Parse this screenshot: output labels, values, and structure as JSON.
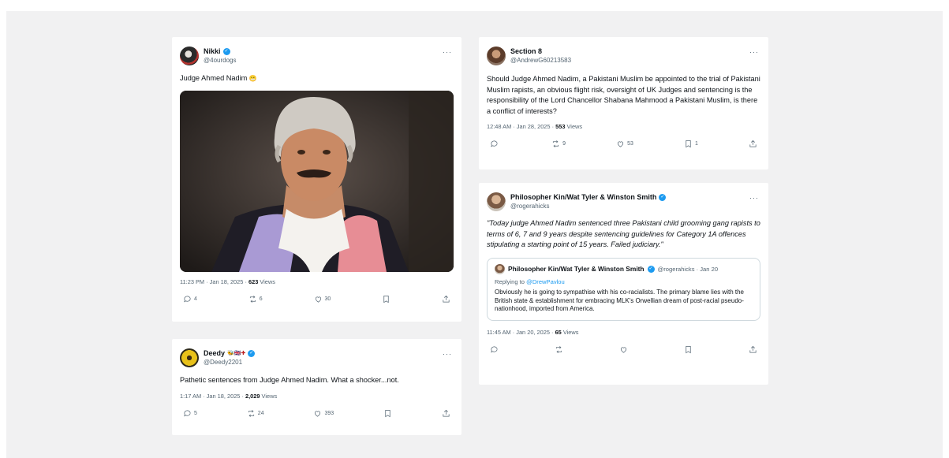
{
  "tweets": [
    {
      "name": "Nikki",
      "handle": "@4ourdogs",
      "text": "Judge Ahmed Nadim",
      "emoji": "😬",
      "time": "11:23 PM · Jan 18, 2025 · ",
      "views_count": "623",
      "views_label": " Views",
      "replies": "4",
      "retweets": "6",
      "likes": "30",
      "bookmarks": "",
      "verified": true
    },
    {
      "name": "Deedy",
      "flags": "🐝🇬🇧✚",
      "handle": "@Deedy2201",
      "text": "Pathetic sentences from Judge Ahmed Nadim. What a shocker...not.",
      "time": "1:17 AM · Jan 18, 2025 · ",
      "views_count": "2,029",
      "views_label": " Views",
      "replies": "5",
      "retweets": "24",
      "likes": "393",
      "verified": true
    },
    {
      "name": "Section 8",
      "handle": "@AndrewG60213583",
      "text": "Should Judge Ahmed Nadim, a Pakistani Muslim be appointed to the trial of Pakistani Muslim rapists, an obvious flight risk, oversight of UK Judges and sentencing is the responsibility of the Lord Chancellor Shabana Mahmood a Pakistani Muslim, is there a conflict of interests?",
      "time": "12:48 AM · Jan 28, 2025 · ",
      "views_count": "553",
      "views_label": " Views",
      "replies": "",
      "retweets": "9",
      "likes": "53",
      "bookmarks": "1"
    },
    {
      "name": "Philosopher Kin/Wat Tyler & Winston Smith",
      "handle": "@rogerahicks",
      "text": "\"Today judge Ahmed Nadim sentenced three Pakistani child grooming gang rapists to terms of 6, 7 and 9 years despite sentencing guidelines for Category 1A offences stipulating a starting point of 15 years.  Failed judiciary.\"",
      "time": "11:45 AM · Jan 20, 2025 · ",
      "views_count": "65",
      "views_label": " Views",
      "verified": true,
      "quote": {
        "name": "Philosopher Kin/Wat Tyler & Winston Smith",
        "handle": "@rogerahicks · Jan 20",
        "replying_prefix": "Replying to ",
        "replying_to": "@DrewPavlou",
        "text": "Obviously he is going to sympathise with his co-racialists. The primary blame lies with the British state & establishment for embracing MLK's Orwellian dream of post-racial pseudo-nationhood, imported from America."
      }
    }
  ],
  "more_label": "···",
  "verified_mark": "✓",
  "colors": {
    "accent": "#1d9bf0",
    "muted": "#536471",
    "text": "#0f1419",
    "background": "#f1f1f2"
  },
  "icons": [
    "reply-icon",
    "retweet-icon",
    "like-icon",
    "bookmark-icon",
    "share-icon",
    "verified-icon",
    "more-icon"
  ]
}
